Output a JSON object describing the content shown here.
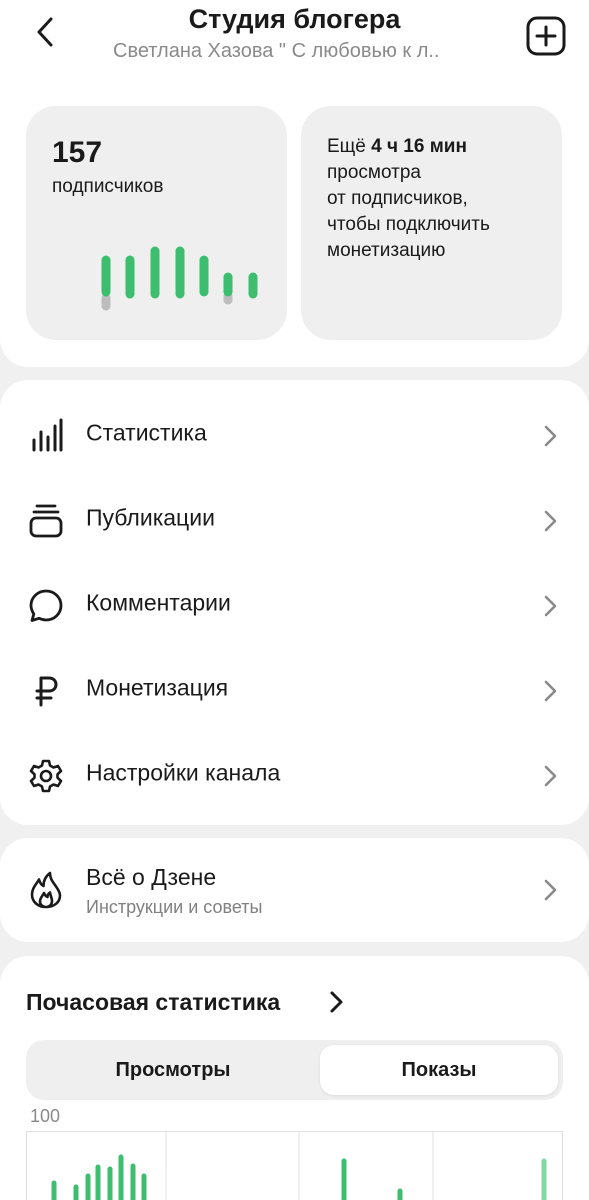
{
  "header": {
    "title": "Студия блогера",
    "subtitle": "Светлана Хазова \" С любовью к л..",
    "back_icon": "chevron-left-icon",
    "add_icon": "plus-square-icon"
  },
  "subscribers_card": {
    "count": "157",
    "label": "подписчиков",
    "chart_color": "#3dbe6e"
  },
  "monetization_card": {
    "prefix": "Ещё ",
    "time": "4 ч 16 мин",
    "line2": "просмотра",
    "line3": "от подписчиков,",
    "line4": "чтобы подключить",
    "line5": "монетизацию"
  },
  "menu": {
    "items": [
      {
        "label": "Статистика",
        "icon": "bar-chart-icon"
      },
      {
        "label": "Публикации",
        "icon": "stack-icon"
      },
      {
        "label": "Комментарии",
        "icon": "comment-icon"
      },
      {
        "label": "Монетизация",
        "icon": "ruble-icon"
      },
      {
        "label": "Настройки канала",
        "icon": "gear-icon"
      }
    ]
  },
  "about": {
    "title": "Всё о Дзене",
    "subtitle": "Инструкции и советы",
    "icon": "flame-icon"
  },
  "hourly": {
    "title": "Почасовая статистика",
    "tabs": {
      "views": "Просмотры",
      "shows": "Показы",
      "selected": "Показы"
    },
    "y_max_label": "100"
  },
  "colors": {
    "accent_green": "#3dbe6e",
    "card_bg": "#efeff0",
    "page_bg": "#f0f0f0"
  }
}
